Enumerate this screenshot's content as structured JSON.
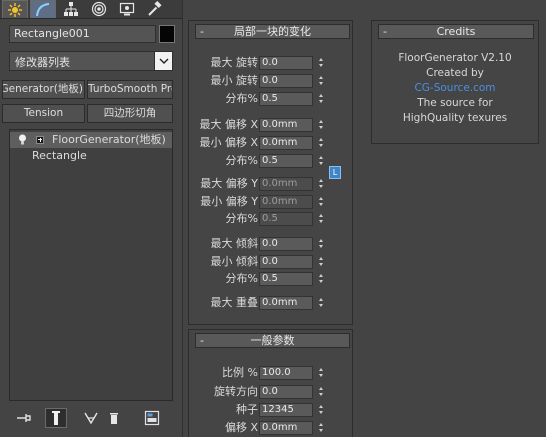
{
  "toolbar": {
    "tabs": [
      {
        "icon": "sun-star-icon"
      },
      {
        "icon": "curve-icon"
      },
      {
        "icon": "hierarchy-icon"
      },
      {
        "icon": "motion-icon"
      },
      {
        "icon": "display-icon"
      },
      {
        "icon": "hammer-icon"
      }
    ]
  },
  "object": {
    "name": "Rectangle001",
    "color": "#050505"
  },
  "modifier_list": {
    "label": "修改器列表"
  },
  "quick_buttons": [
    "FloorGenerator(地板)",
    "TurboSmooth Pro",
    "Tension",
    "四边形切角"
  ],
  "stack": {
    "items": [
      {
        "label": "FloorGenerator(地板)"
      },
      {
        "label": "Rectangle"
      }
    ]
  },
  "local_changes": {
    "title": "局部一块的变化",
    "collapse_glyph": "-",
    "lock_label": "L",
    "params": [
      {
        "label": "最大 旋转",
        "value": "0.0"
      },
      {
        "label": "最小 旋转",
        "value": "0.0"
      },
      {
        "label": "分布%",
        "value": "0.5"
      },
      {
        "label": "最大 偏移 X",
        "value": "0.0mm"
      },
      {
        "label": "最小 偏移 X",
        "value": "0.0mm"
      },
      {
        "label": "分布%",
        "value": "0.5"
      },
      {
        "label": "最大 偏移 Y",
        "value": "0.0mm"
      },
      {
        "label": "最小 偏移 Y",
        "value": "0.0mm"
      },
      {
        "label": "分布%",
        "value": "0.5"
      },
      {
        "label": "最大 倾斜",
        "value": "0.0"
      },
      {
        "label": "最小 倾斜",
        "value": "0.0"
      },
      {
        "label": "分布%",
        "value": "0.5"
      },
      {
        "label": "最大 重叠",
        "value": "0.0mm"
      }
    ]
  },
  "general_params": {
    "title": "一般参数",
    "collapse_glyph": "-",
    "params": [
      {
        "label": "比例 %",
        "value": "100.0"
      },
      {
        "label": "旋转方向",
        "value": "0.0"
      },
      {
        "label": "种子",
        "value": "12345"
      },
      {
        "label": "偏移 X",
        "value": "0.0mm"
      }
    ]
  },
  "credits": {
    "title": "Credits",
    "collapse_glyph": "-",
    "version": "FloorGenerator V2.10",
    "created_by": "Created by",
    "link": "CG-Source.com",
    "line1": "The source for",
    "line2": "HighQuality texures",
    "link_color": "#4a8fe0"
  }
}
